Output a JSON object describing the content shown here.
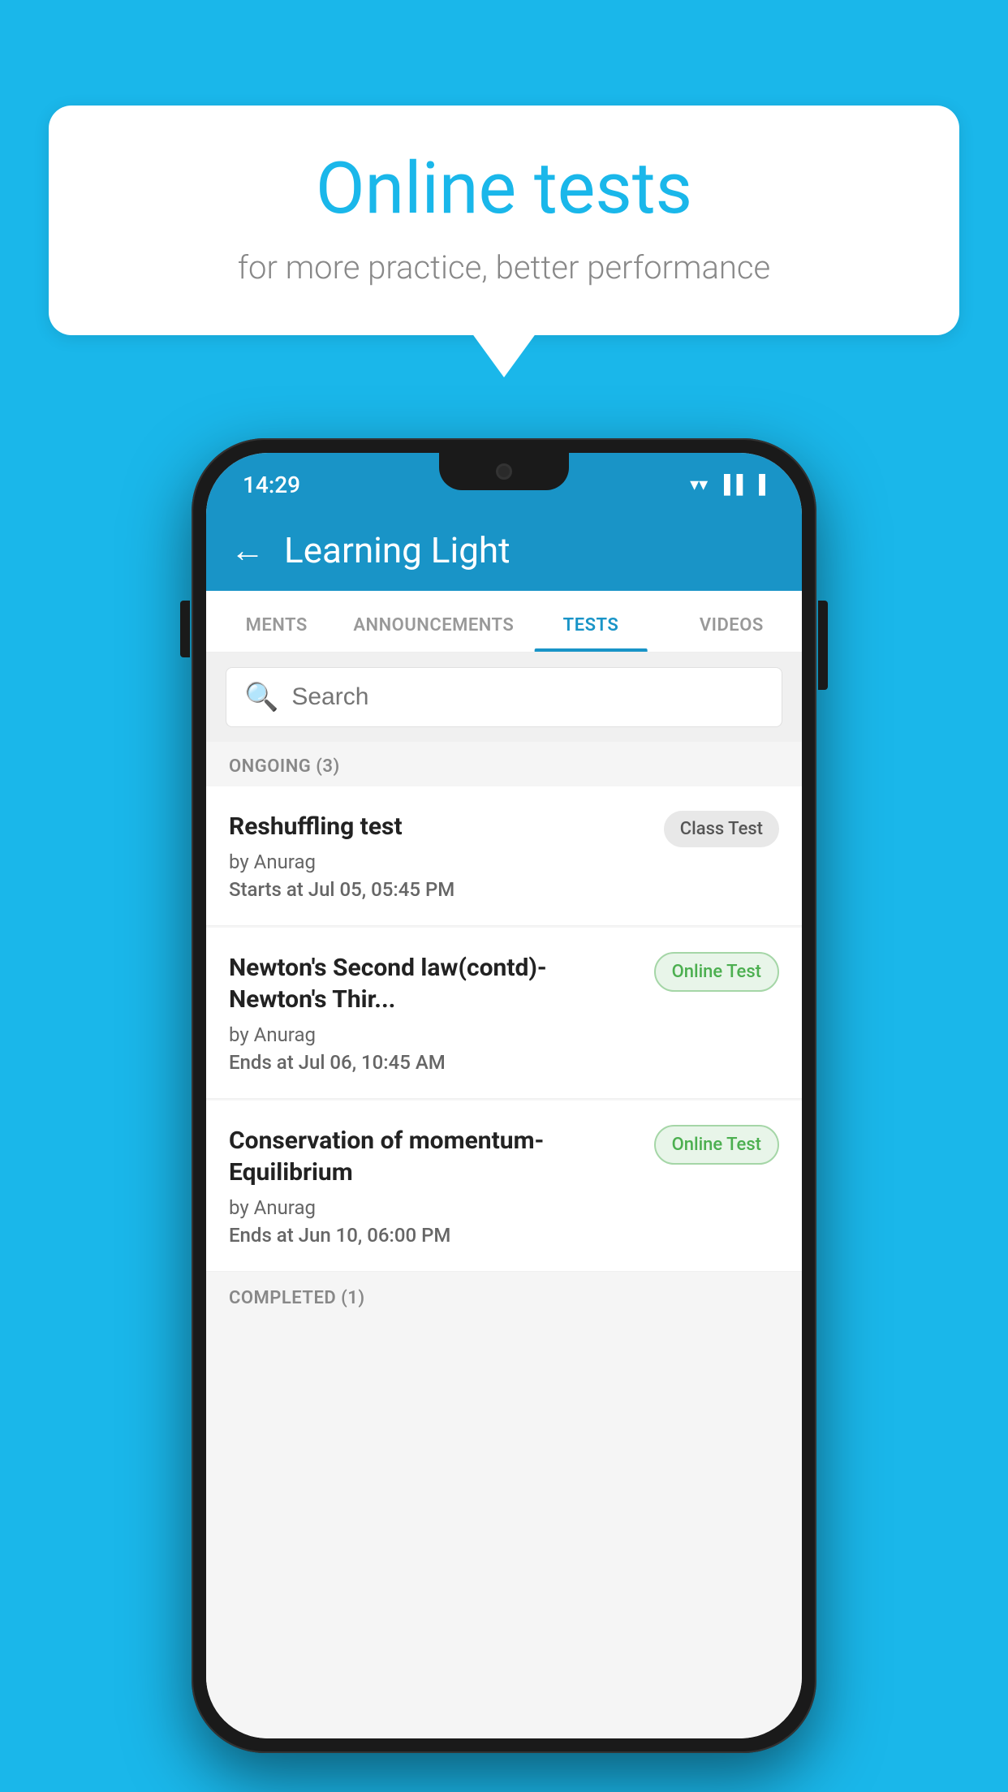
{
  "background_color": "#1ab7ea",
  "speech_bubble": {
    "title": "Online tests",
    "subtitle": "for more practice, better performance"
  },
  "status_bar": {
    "time": "14:29",
    "wifi": "▼",
    "signal": "▲",
    "battery": "▐"
  },
  "app_bar": {
    "title": "Learning Light",
    "back_label": "←"
  },
  "tabs": [
    {
      "label": "MENTS",
      "active": false
    },
    {
      "label": "ANNOUNCEMENTS",
      "active": false
    },
    {
      "label": "TESTS",
      "active": true
    },
    {
      "label": "VIDEOS",
      "active": false
    }
  ],
  "search": {
    "placeholder": "Search"
  },
  "ongoing_section": {
    "header": "ONGOING (3)",
    "tests": [
      {
        "title": "Reshuffling test",
        "author": "by Anurag",
        "date_label": "Starts at",
        "date_value": "Jul 05, 05:45 PM",
        "badge": "Class Test",
        "badge_type": "class"
      },
      {
        "title": "Newton's Second law(contd)-Newton's Thir...",
        "author": "by Anurag",
        "date_label": "Ends at",
        "date_value": "Jul 06, 10:45 AM",
        "badge": "Online Test",
        "badge_type": "online"
      },
      {
        "title": "Conservation of momentum-Equilibrium",
        "author": "by Anurag",
        "date_label": "Ends at",
        "date_value": "Jun 10, 06:00 PM",
        "badge": "Online Test",
        "badge_type": "online"
      }
    ]
  },
  "completed_section": {
    "header": "COMPLETED (1)"
  }
}
